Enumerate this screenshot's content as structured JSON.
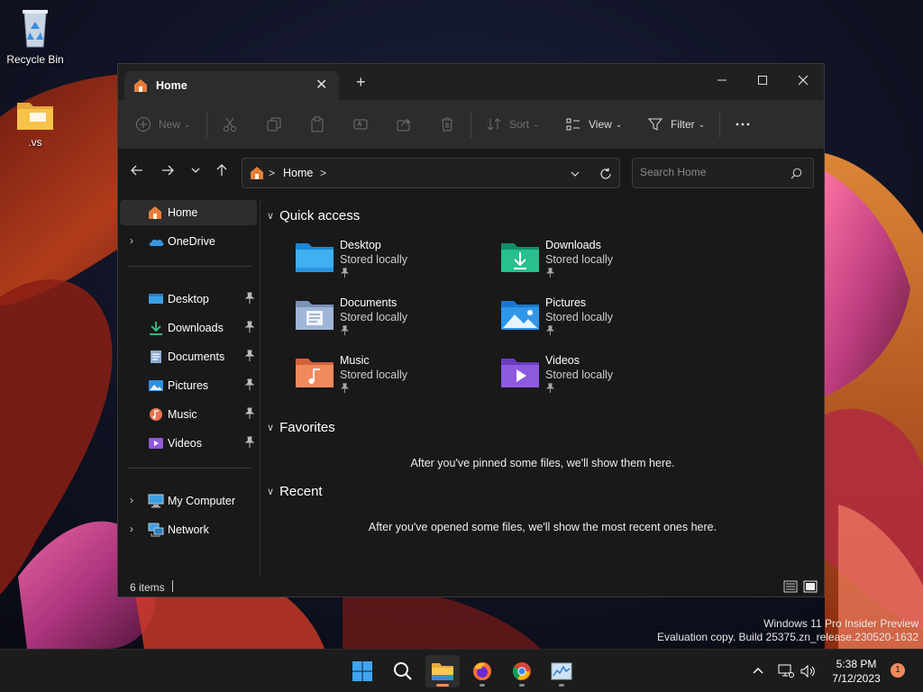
{
  "desktop": {
    "icons": [
      {
        "label": "Recycle Bin"
      },
      {
        "label": ".vs"
      }
    ],
    "watermark": {
      "line1": "Windows 11 Pro Insider Preview",
      "line2": "Evaluation copy. Build 25375.zn_release.230520-1632"
    }
  },
  "explorer": {
    "tab": {
      "label": "Home",
      "close_icon": "close-icon"
    },
    "new_tab_icon": "plus-icon",
    "window_controls": [
      "minimize-icon",
      "maximize-icon",
      "close-icon"
    ],
    "toolbar": {
      "new_label": "New",
      "sort_label": "Sort",
      "view_label": "View",
      "filter_label": "Filter",
      "more_icon": "more-icon"
    },
    "address": {
      "path": [
        "Home"
      ],
      "separator": ">"
    },
    "search": {
      "placeholder": "Search Home"
    },
    "nav": {
      "home": "Home",
      "onedrive": "OneDrive",
      "pinned": [
        {
          "label": "Desktop",
          "icon": "desktop-icon"
        },
        {
          "label": "Downloads",
          "icon": "downloads-icon"
        },
        {
          "label": "Documents",
          "icon": "documents-icon"
        },
        {
          "label": "Pictures",
          "icon": "pictures-icon"
        },
        {
          "label": "Music",
          "icon": "music-icon"
        },
        {
          "label": "Videos",
          "icon": "videos-icon"
        }
      ],
      "my_computer": "My Computer",
      "network": "Network"
    },
    "sections": {
      "quick_access": "Quick access",
      "favorites": "Favorites",
      "recent": "Recent"
    },
    "quick_access": [
      {
        "name": "Desktop",
        "sub": "Stored locally",
        "icon": "desktop-folder-icon"
      },
      {
        "name": "Downloads",
        "sub": "Stored locally",
        "icon": "downloads-folder-icon"
      },
      {
        "name": "Documents",
        "sub": "Stored locally",
        "icon": "documents-folder-icon"
      },
      {
        "name": "Pictures",
        "sub": "Stored locally",
        "icon": "pictures-folder-icon"
      },
      {
        "name": "Music",
        "sub": "Stored locally",
        "icon": "music-folder-icon"
      },
      {
        "name": "Videos",
        "sub": "Stored locally",
        "icon": "videos-folder-icon"
      }
    ],
    "favorites_empty": "After you've pinned some files, we'll show them here.",
    "recent_empty": "After you've opened some files, we'll show the most recent ones here.",
    "status": {
      "items": "6 items"
    }
  },
  "taskbar": {
    "apps": [
      "start-icon",
      "search-icon",
      "file-explorer-icon",
      "firefox-icon",
      "chrome-icon",
      "task-manager-icon"
    ],
    "clock": {
      "time": "5:38 PM",
      "date": "7/12/2023"
    },
    "notification_count": "1"
  },
  "colors": {
    "accent": "#ff8a5a",
    "window_bg": "#191919",
    "toolbar_bg": "#2c2c2c"
  }
}
